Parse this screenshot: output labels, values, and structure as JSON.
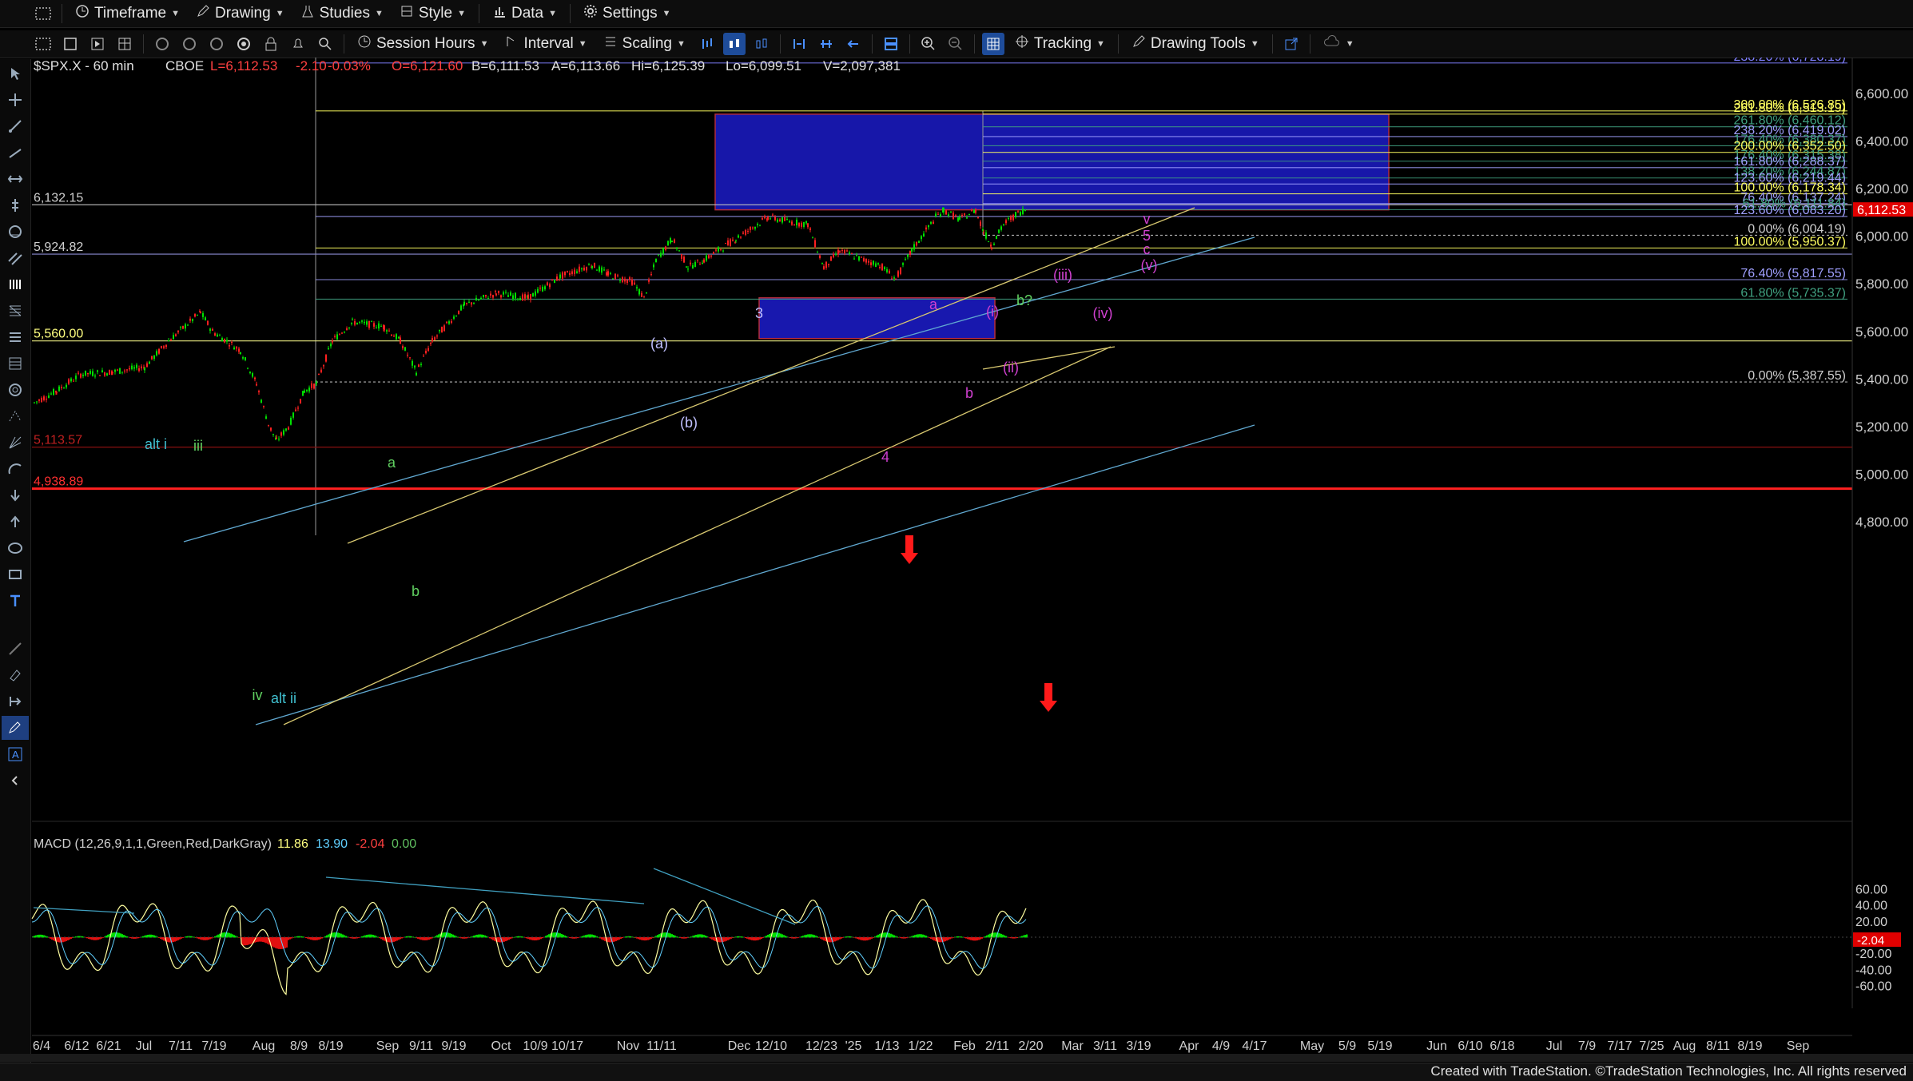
{
  "toolbar_top": {
    "items": [
      {
        "label": "Timeframe",
        "icon": "clock-icon"
      },
      {
        "label": "Drawing",
        "icon": "pencil-icon"
      },
      {
        "label": "Studies",
        "icon": "flask-icon"
      },
      {
        "label": "Style",
        "icon": "style-icon"
      },
      {
        "label": "Data",
        "icon": "bar-chart-icon"
      },
      {
        "label": "Settings",
        "icon": "gear-icon"
      }
    ]
  },
  "toolbar_second": {
    "session_hours": "Session Hours",
    "interval": "Interval",
    "scaling": "Scaling",
    "tracking": "Tracking",
    "drawing_tools": "Drawing Tools"
  },
  "header": {
    "symbol": "$SPX.X - 60 min",
    "exchange": "CBOE",
    "last": "L=6,112.53",
    "change": "-2.10",
    "change_pct": "-0.03%",
    "open": "O=6,121.60",
    "bid": "B=6,111.53",
    "ask": "A=6,113.66",
    "high": "Hi=6,125.39",
    "low": "Lo=6,099.51",
    "volume": "V=2,097,381"
  },
  "colors": {
    "up": "#00ff00",
    "down": "#ff2020",
    "price_text": "#ff5050",
    "accent_blue": "#1e1e9e"
  },
  "price_axis": {
    "ticks": [
      "6,600.00",
      "6,400.00",
      "6,200.00",
      "6,000.00",
      "5,800.00",
      "5,600.00",
      "5,400.00",
      "5,200.00",
      "5,000.00",
      "4,800.00"
    ],
    "last_price_tag": "6,112.53"
  },
  "left_levels": [
    {
      "label": "6,132.15",
      "color": "#d0d0d0"
    },
    {
      "label": "5,924.82",
      "color": "#d0d0d0"
    },
    {
      "label": "5,560.00",
      "color": "#ffff80"
    },
    {
      "label": "5,113.57",
      "color": "#c02020"
    },
    {
      "label": "4,938.89",
      "color": "#ff3030"
    }
  ],
  "fib_labels": [
    {
      "text": "238.20% (6,728.19)",
      "color": "#8080ff"
    },
    {
      "text": "300.00% (6,526.85)",
      "color": "#ffff60"
    },
    {
      "text": "261.80% (6,513.19)",
      "color": "#ffff60"
    },
    {
      "text": "261.80% (6,460.12)",
      "color": "#40a080"
    },
    {
      "text": "238.20% (6,419.02)",
      "color": "#a0a0ff"
    },
    {
      "text": "176.40% (6,380.37)",
      "color": "#40a080"
    },
    {
      "text": "200.00% (6,352.50)",
      "color": "#ffff60"
    },
    {
      "text": "176.40% (6,315.38)",
      "color": "#40a080"
    },
    {
      "text": "161.80% (6,288.37)",
      "color": "#a0a0ff"
    },
    {
      "text": "138.20% (6,244.87)",
      "color": "#40a080"
    },
    {
      "text": "123.60% (6,219.44)",
      "color": "#a0a0ff"
    },
    {
      "text": "100.00% (6,178.34)",
      "color": "#ffff60"
    },
    {
      "text": "76.40% (6,137.24)",
      "color": "#a0a0ff"
    },
    {
      "text": "61.80% (6,111.84)",
      "color": "#40a080"
    },
    {
      "text": "123.60% (6,083.20)",
      "color": "#a0a0ff"
    },
    {
      "text": "0.00% (6,004.19)",
      "color": "#d0d0d0"
    },
    {
      "text": "100.00% (5,950.37)",
      "color": "#ffff60"
    },
    {
      "text": "76.40% (5,817.55)",
      "color": "#a0a0ff"
    },
    {
      "text": "61.80% (5,735.37)",
      "color": "#40a080"
    },
    {
      "text": "0.00% (5,387.55)",
      "color": "#d0d0d0"
    }
  ],
  "wave_labels": [
    {
      "text": "alt i",
      "color": "#40c0d0"
    },
    {
      "text": "iii",
      "color": "#60d060"
    },
    {
      "text": "iv",
      "color": "#60d060"
    },
    {
      "text": "alt ii",
      "color": "#40c0d0"
    },
    {
      "text": "a",
      "color": "#60d060"
    },
    {
      "text": "b",
      "color": "#60d060"
    },
    {
      "text": "(a)",
      "color": "#c0c0ff"
    },
    {
      "text": "(b)",
      "color": "#c0c0ff"
    },
    {
      "text": "3",
      "color": "#c0c0ff"
    },
    {
      "text": "4",
      "color": "#d040d0"
    },
    {
      "text": "a",
      "color": "#d040d0"
    },
    {
      "text": "b",
      "color": "#d040d0"
    },
    {
      "text": "(i)",
      "color": "#d040d0"
    },
    {
      "text": "(ii)",
      "color": "#d040d0"
    },
    {
      "text": "b?",
      "color": "#60d060"
    },
    {
      "text": "(iii)",
      "color": "#d040d0"
    },
    {
      "text": "(iv)",
      "color": "#d040d0"
    },
    {
      "text": "v",
      "color": "#d040d0"
    },
    {
      "text": "5",
      "color": "#d040d0"
    },
    {
      "text": "c",
      "color": "#d040d0"
    },
    {
      "text": "(v)",
      "color": "#d040d0"
    }
  ],
  "time_axis": {
    "labels": [
      "6/4",
      "6/12",
      "6/21",
      "Jul",
      "7/11",
      "7/19",
      "Aug",
      "8/9",
      "8/19",
      "Sep",
      "9/11",
      "9/19",
      "Oct",
      "10/9",
      "10/17",
      "Nov",
      "11/11",
      "Dec",
      "12/10",
      "12/23",
      "'25",
      "1/13",
      "1/22",
      "Feb",
      "2/11",
      "2/20",
      "Mar",
      "3/11",
      "3/19",
      "Apr",
      "4/9",
      "4/17",
      "May",
      "5/9",
      "5/19",
      "Jun",
      "6/10",
      "6/18",
      "Jul",
      "7/9",
      "7/17",
      "7/25",
      "Aug",
      "8/11",
      "8/19",
      "Sep"
    ]
  },
  "macd": {
    "title": "MACD (12,26,9,1,1,Green,Red,DarkGray)",
    "values": [
      "11.86",
      "13.90",
      "-2.04",
      "0.00"
    ],
    "ticks": [
      "60.00",
      "40.00",
      "20.00",
      "-20.00",
      "-40.00",
      "-60.00"
    ],
    "tag": "-2.04"
  },
  "footer": {
    "credit": "Created with TradeStation. ©TradeStation Technologies, Inc. All rights reserved"
  }
}
